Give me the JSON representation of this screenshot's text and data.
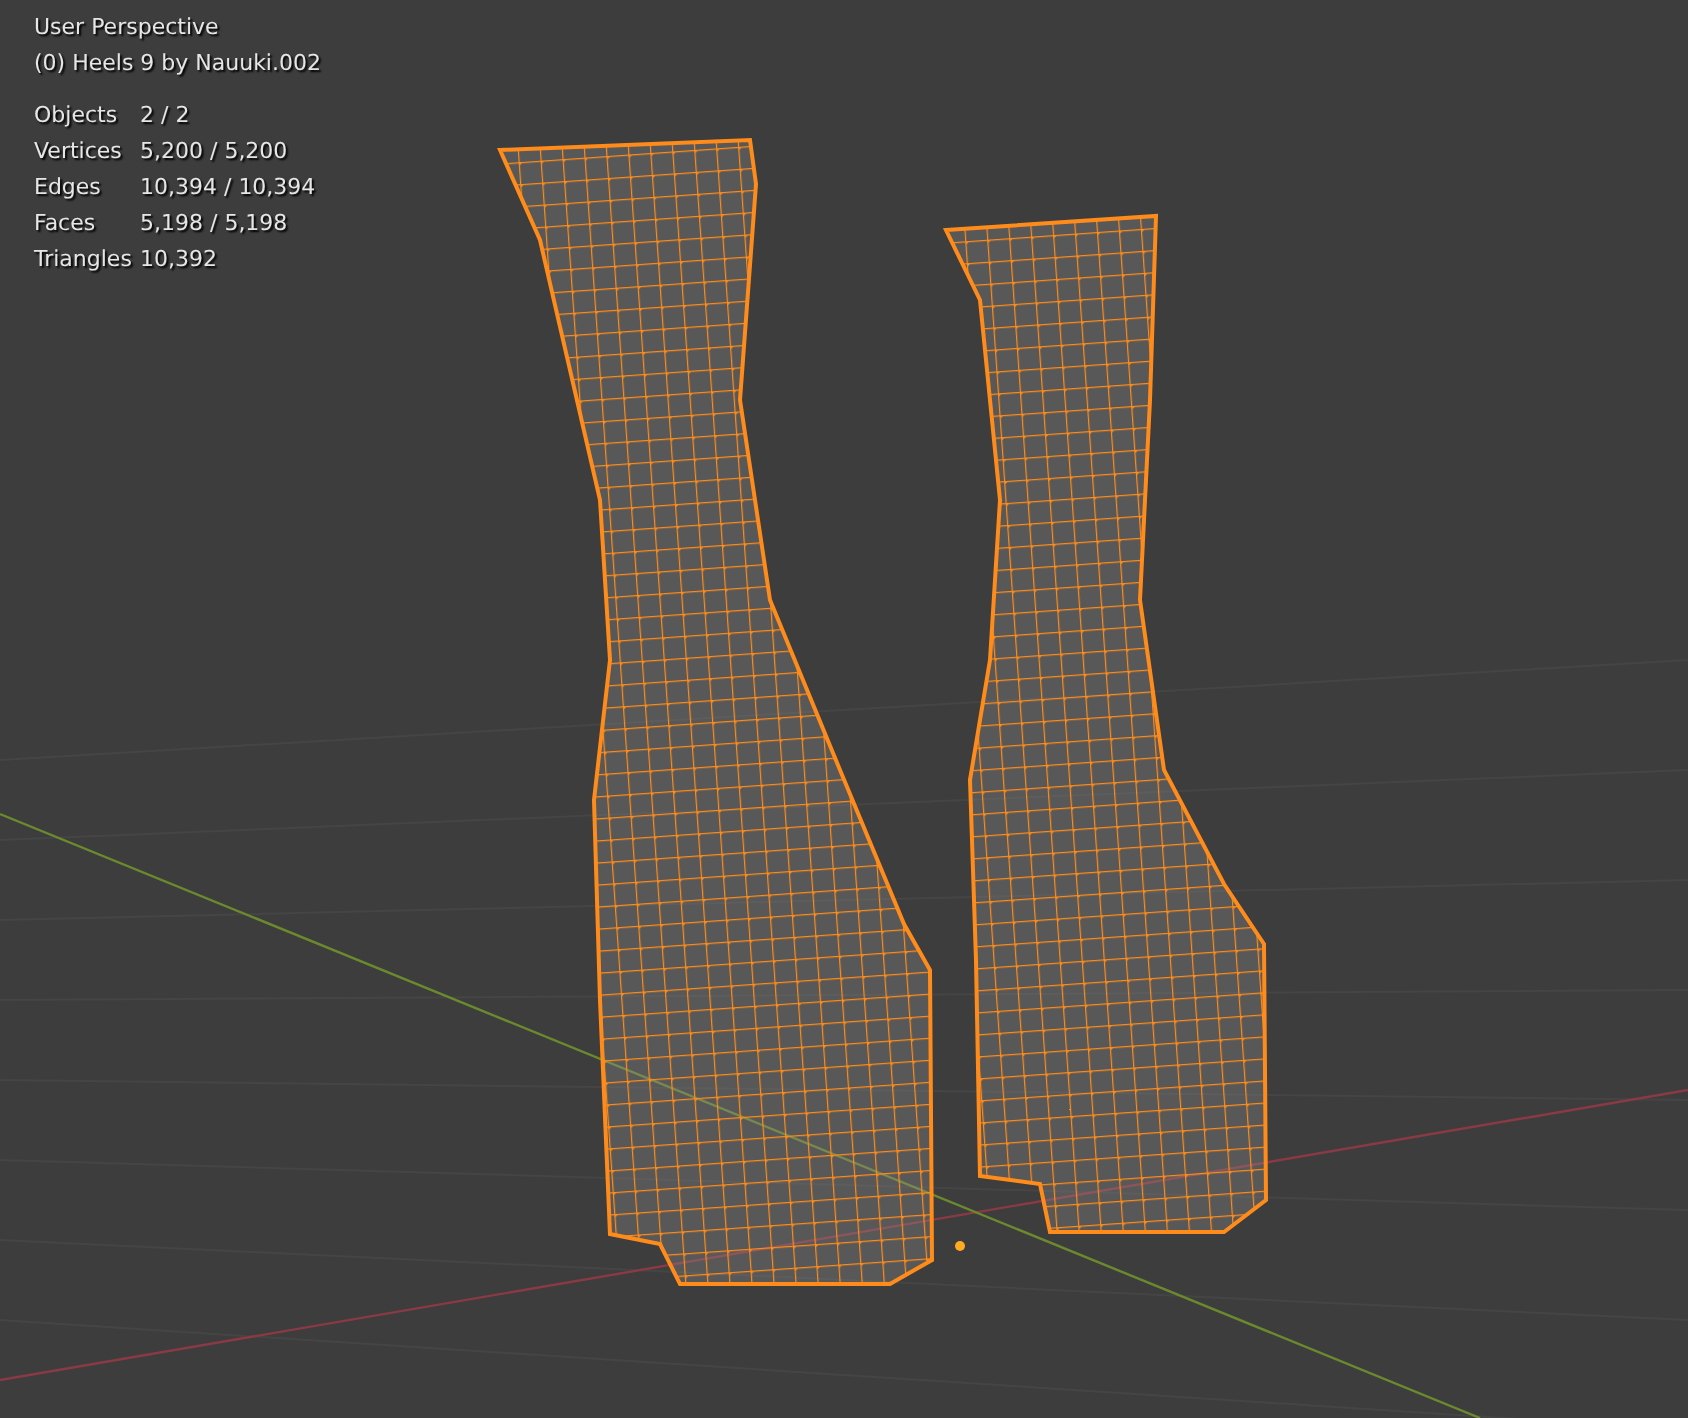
{
  "viewport": {
    "view_name": "User Perspective",
    "object_info": "(0) Heels 9 by Nauuki.002",
    "stats": [
      {
        "label": "Objects",
        "value": "2 / 2"
      },
      {
        "label": "Vertices",
        "value": "5,200 / 5,200"
      },
      {
        "label": "Edges",
        "value": "10,394 / 10,394"
      },
      {
        "label": "Faces",
        "value": "5,198 / 5,198"
      },
      {
        "label": "Triangles",
        "value": "10,392"
      }
    ]
  }
}
